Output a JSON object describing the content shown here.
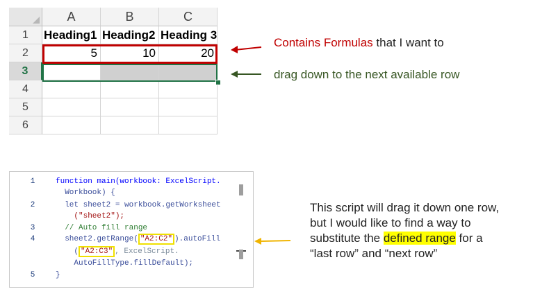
{
  "sheet": {
    "columns": [
      "A",
      "B",
      "C"
    ],
    "rows": [
      "1",
      "2",
      "3",
      "4",
      "5",
      "6"
    ],
    "headings": [
      "Heading1",
      "Heading2",
      "Heading 3"
    ],
    "row2_values": [
      "5",
      "10",
      "20"
    ]
  },
  "annotations": {
    "note1_red": "Contains Formulas",
    "note1_rest": " that I want to",
    "note2": "drag down to the next available row"
  },
  "code": {
    "lines": [
      {
        "num": "1",
        "text": "function main(workbook: ExcelScript."
      },
      {
        "num": "",
        "text": "  Workbook) {"
      },
      {
        "num": "2",
        "text": "  let sheet2 = workbook.getWorksheet"
      },
      {
        "num": "",
        "text": "    (\"sheet2\");"
      },
      {
        "num": "3",
        "text": "  // Auto fill range"
      },
      {
        "num": "4",
        "text_parts": [
          "  sheet2.getRange(",
          "\"A2:C2\"",
          ").autoFill"
        ]
      },
      {
        "num": "",
        "text_parts": [
          "    (",
          "\"A2:C3\"",
          ", ExcelScript."
        ]
      },
      {
        "num": "",
        "text": "    AutoFillType.fillDefault);"
      },
      {
        "num": "5",
        "text": "}"
      }
    ]
  },
  "explanation": {
    "line1": "This script will drag it down one row,",
    "line2": "but I would like to find a way to",
    "line3_pre": "substitute the ",
    "line3_hl": "defined range",
    "line3_post": " for a",
    "line4": "“last row” and “next row”"
  },
  "colors": {
    "red": "#c00000",
    "green": "#217346",
    "dark_green": "#375623",
    "yellow": "#ffff00",
    "orange_arrow": "#f0b400"
  }
}
